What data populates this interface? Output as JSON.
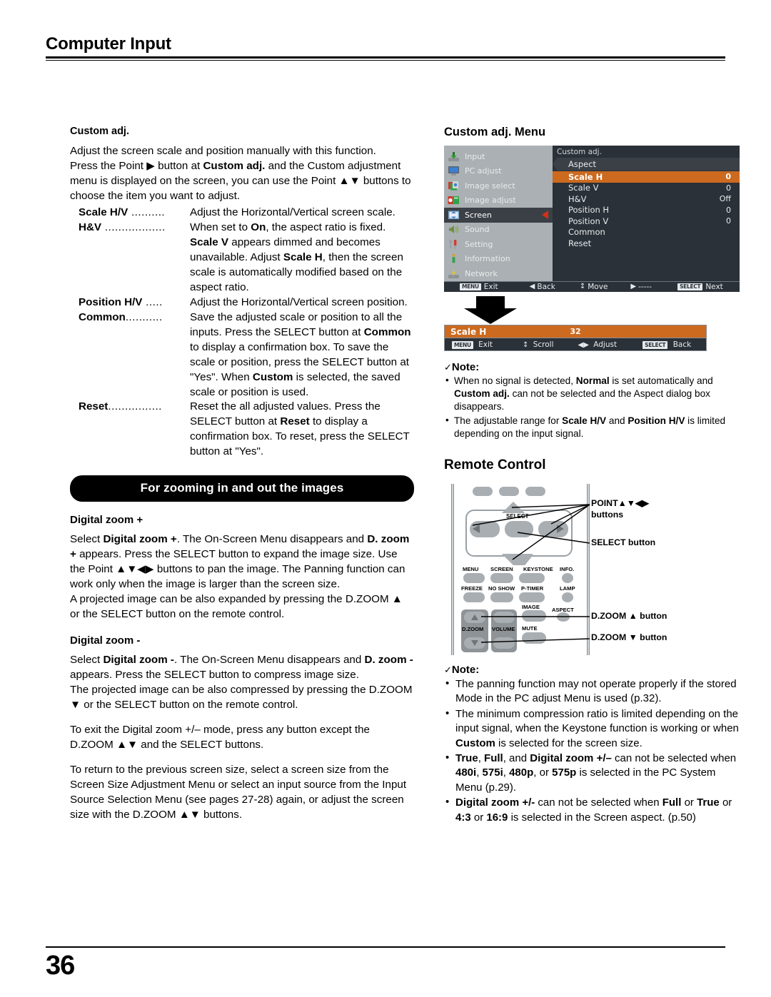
{
  "header": {
    "title": "Computer Input"
  },
  "footer": {
    "page_number": "36"
  },
  "left": {
    "custom_adj_heading": "Custom adj.",
    "intro_1": "Adjust the screen scale and position manually with this function.",
    "intro_2_a": "Press the Point ",
    "intro_2_arrow": "▶",
    "intro_2_b": " button at ",
    "intro_2_bold": "Custom adj.",
    "intro_2_c": " and the Custom adjustment menu is displayed on the screen, you can use the Point ",
    "intro_2_arrows": "▲▼",
    "intro_2_d": " buttons to choose the item you want to adjust.",
    "items": [
      {
        "term": "Scale H/V",
        "dots": " ..........",
        "desc": "Adjust the Horizontal/Vertical screen scale."
      },
      {
        "term": "H&V",
        "dots": " ..................",
        "desc": "When set to On, the aspect ratio is fixed. Scale V appears dimmed and becomes unavailable. Adjust Scale H, then the screen scale is automatically modified based on the aspect ratio."
      },
      {
        "term": "Position H/V",
        "dots": " .....",
        "desc": "Adjust the Horizontal/Vertical screen position."
      },
      {
        "term": "Common",
        "dots": "...........",
        "desc": "Save the adjusted scale or position to all the inputs. Press the SELECT button at Common to display a confirmation box. To save the scale or position, press the SELECT button at \"Yes\". When Custom is selected, the saved scale or position is used."
      },
      {
        "term": "Reset",
        "dots": "................",
        "desc": "Reset the all adjusted values. Press the SELECT button at Reset to display a confirmation box. To reset, press the SELECT button at \"Yes\"."
      }
    ],
    "banner": "For zooming in and out the images",
    "dz_plus_heading": "Digital zoom +",
    "dz_plus_p1": "Select Digital zoom +. The On-Screen Menu disappears and D. zoom + appears. Press the SELECT button to expand the image size. Use the Point ▲▼◀▶ buttons to pan the image. The Panning function can work only when the image is larger than the screen size.",
    "dz_plus_p2": "A projected image can be also expanded by pressing the D.ZOOM ▲ or the SELECT button on the remote control.",
    "dz_minus_heading": "Digital zoom -",
    "dz_minus_p1": "Select Digital zoom -. The On-Screen Menu disappears and D. zoom - appears. Press the SELECT button to compress image size.",
    "dz_minus_p2": "The projected image can be also compressed by pressing the D.ZOOM ▼ or the SELECT button on the remote control.",
    "exit_p": "To exit the Digital zoom +/– mode, press any button except the D.ZOOM ▲▼ and the SELECT buttons.",
    "return_p": "To return to the previous screen size, select a screen size from the Screen Size Adjustment Menu or select an input source from the Input Source Selection Menu (see pages 27-28) again, or adjust the screen size with the D.ZOOM ▲▼ buttons."
  },
  "right": {
    "osd_heading": "Custom adj. Menu",
    "osd": {
      "sidebar": [
        {
          "label": "Input",
          "icon": "input-icon"
        },
        {
          "label": "PC adjust",
          "icon": "monitor-icon"
        },
        {
          "label": "Image select",
          "icon": "image-select-icon"
        },
        {
          "label": "Image adjust",
          "icon": "contrast-icon"
        },
        {
          "label": "Screen",
          "icon": "screen-icon",
          "selected": true
        },
        {
          "label": "Sound",
          "icon": "speaker-icon"
        },
        {
          "label": "Setting",
          "icon": "tools-icon"
        },
        {
          "label": "Information",
          "icon": "info-icon"
        },
        {
          "label": "Network",
          "icon": "network-icon"
        }
      ],
      "panel_title": "Custom adj.",
      "panel_tab": "Aspect",
      "rows": [
        {
          "label": "Scale H",
          "value": "0",
          "highlighted": true
        },
        {
          "label": "Scale V",
          "value": "0"
        },
        {
          "label": "H&V",
          "value": "Off"
        },
        {
          "label": "Position H",
          "value": "0"
        },
        {
          "label": "Position V",
          "value": "0"
        },
        {
          "label": "Common",
          "value": ""
        },
        {
          "label": "Reset",
          "value": ""
        }
      ],
      "footer": [
        {
          "key": "MENU",
          "glyph": "",
          "label": "Exit"
        },
        {
          "key": "",
          "glyph": "◀",
          "label": "Back"
        },
        {
          "key": "",
          "glyph": "↕",
          "label": "Move"
        },
        {
          "key": "",
          "glyph": "▶",
          "label": "-----"
        },
        {
          "key": "SELECT",
          "glyph": "",
          "label": "Next"
        }
      ]
    },
    "scale_bar": {
      "label": "Scale H",
      "value": "32",
      "footer": [
        {
          "key": "MENU",
          "glyph": "",
          "label": "Exit"
        },
        {
          "key": "",
          "glyph": "↕",
          "label": "Scroll"
        },
        {
          "key": "",
          "glyph": "◀▶",
          "label": "Adjust"
        },
        {
          "key": "SELECT",
          "glyph": "",
          "label": "Back"
        }
      ]
    },
    "note1": {
      "heading": "Note:",
      "check": "✓",
      "items": [
        "When no signal is detected, Normal is set automatically and Custom adj. can not be selected and the Aspect dialog box disappears.",
        "The adjustable range for Scale H/V and Position H/V is limited depending on the input signal."
      ]
    },
    "remote_heading": "Remote Control",
    "remote": {
      "buttons": [
        "MENU",
        "SCREEN",
        "KEYSTONE",
        "INFO.",
        "FREEZE",
        "NO SHOW",
        "P-TIMER",
        "LAMP",
        "IMAGE",
        "ASPECT",
        "D.ZOOM",
        "VOLUME",
        "MUTE"
      ],
      "select_label": "SELECT",
      "callouts": [
        "POINT▲▼◀▶",
        "buttons",
        "SELECT button",
        "D.ZOOM ▲ button",
        "D.ZOOM ▼ button"
      ]
    },
    "note2": {
      "heading": "Note:",
      "check": "✓",
      "items": [
        "The panning function may not operate properly if the stored Mode in the PC adjust Menu is used (p.32).",
        "The minimum compression ratio is limited depending on the input signal, when the Keystone function is working or when Custom is selected for the screen size.",
        "True, Full, and Digital zoom +/– can not be selected when 480i, 575i, 480p, or 575p is selected in the PC System Menu (p.29).",
        "Digital zoom +/- can not be selected when Full or True or 4:3 or 16:9  is selected in the Screen aspect. (p.50)"
      ]
    }
  }
}
